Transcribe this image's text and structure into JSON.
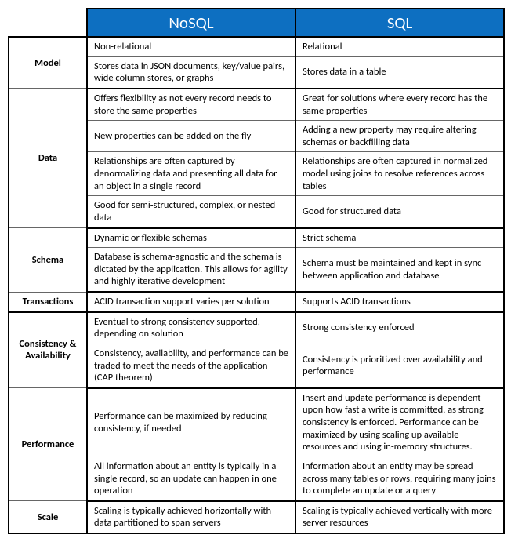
{
  "headers": {
    "col1": "NoSQL",
    "col2": "SQL"
  },
  "sections": {
    "model": {
      "label": "Model",
      "rows": [
        {
          "nosql": "Non-relational",
          "sql": "Relational"
        },
        {
          "nosql": "Stores data in JSON documents, key/value pairs, wide column stores, or graphs",
          "sql": "Stores data in a table"
        }
      ]
    },
    "data": {
      "label": "Data",
      "rows": [
        {
          "nosql": "Offers flexibility as not every record needs to store the same properties",
          "sql": "Great for solutions where every record has the same properties"
        },
        {
          "nosql": "New properties can be added on the fly",
          "sql": "Adding a new property may require altering schemas or backfilling data"
        },
        {
          "nosql": "Relationships are often captured by denormalizing data and presenting all data for an object in a single record",
          "sql": "Relationships are often captured in normalized model using joins to resolve references across tables"
        },
        {
          "nosql": "Good for semi-structured, complex, or nested data",
          "sql": "Good for structured data"
        }
      ]
    },
    "schema": {
      "label": "Schema",
      "rows": [
        {
          "nosql": "Dynamic or flexible schemas",
          "sql": "Strict schema"
        },
        {
          "nosql": "Database is schema-agnostic and the schema is dictated by the application. This allows for agility and highly iterative development",
          "sql": "Schema must be maintained and kept in sync between application and database"
        }
      ]
    },
    "transactions": {
      "label": "Transactions",
      "rows": [
        {
          "nosql": "ACID transaction support varies per solution",
          "sql": "Supports ACID transactions"
        }
      ]
    },
    "consistency": {
      "label": "Consistency & Availability",
      "rows": [
        {
          "nosql": "Eventual to strong consistency supported, depending on solution",
          "sql": "Strong consistency enforced"
        },
        {
          "nosql": "Consistency, availability, and performance can be traded to meet the needs of the application (CAP theorem)",
          "sql": "Consistency is prioritized over availability and performance"
        }
      ]
    },
    "performance": {
      "label": "Performance",
      "rows": [
        {
          "nosql": "Performance can be maximized by reducing consistency, if needed",
          "sql": "Insert and update performance is dependent upon how fast a write is committed, as strong consistency is enforced. Performance can be maximized by using scaling up available resources and using in-memory structures."
        },
        {
          "nosql": "All information about an entity is typically in a single record, so an update can happen in one operation",
          "sql": "Information about an entity may be spread across many tables or rows, requiring many joins to complete an update or a query"
        }
      ]
    },
    "scale": {
      "label": "Scale",
      "rows": [
        {
          "nosql": "Scaling is typically achieved horizontally with data partitioned to span servers",
          "sql": "Scaling is typically achieved vertically with more server resources"
        }
      ]
    }
  }
}
